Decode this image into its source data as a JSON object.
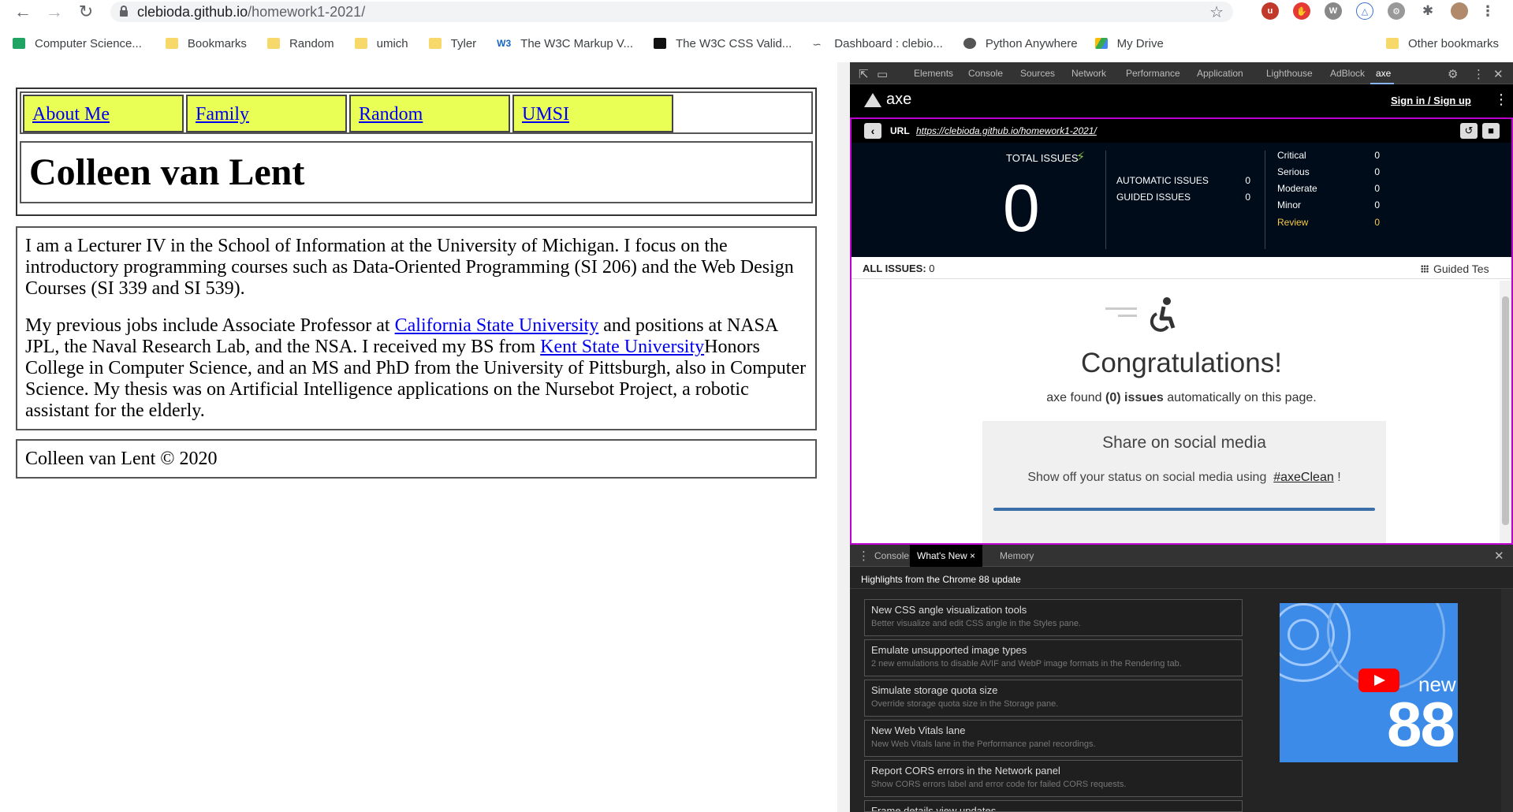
{
  "browser": {
    "url_host": "clebioda.github.io",
    "url_path": "/homework1-2021/",
    "bookmarks": [
      {
        "label": "Computer Science..."
      },
      {
        "label": "Bookmarks"
      },
      {
        "label": "Random"
      },
      {
        "label": "umich"
      },
      {
        "label": "Tyler"
      },
      {
        "label": "The W3C Markup V..."
      },
      {
        "label": "The W3C CSS Valid..."
      },
      {
        "label": "Dashboard : clebio..."
      },
      {
        "label": "Python Anywhere"
      },
      {
        "label": "My Drive"
      }
    ],
    "other_bookmarks": "Other bookmarks"
  },
  "page": {
    "nav": [
      "About Me",
      "Family",
      "Random",
      "UMSI"
    ],
    "title": "Colleen van Lent",
    "p1": "I am a Lecturer IV in the School of Information at the University of Michigan. I focus on the introductory programming courses such as Data-Oriented Programming (SI 206) and the Web Design Courses (SI 339 and SI 539).",
    "p2_a": "My previous jobs include Associate Professor at ",
    "p2_link1": "California State University",
    "p2_b": " and positions at NASA JPL, the Naval Research Lab, and the NSA. I received my BS from ",
    "p2_link2": "Kent State University",
    "p2_c": "Honors College in Computer Science, and an MS and PhD from the University of Pittsburgh, also in Computer Science. My thesis was on Artificial Intelligence applications on the Nursebot Project, a robotic assistant for the elderly.",
    "footer": "Colleen van Lent © 2020"
  },
  "devtools": {
    "tabs": [
      "Elements",
      "Console",
      "Sources",
      "Network",
      "Performance",
      "Application",
      "Lighthouse",
      "AdBlock",
      "axe"
    ],
    "active_tab": "axe",
    "axe": {
      "brand": "axe",
      "sign_in": "Sign in / Sign up",
      "url_label": "URL",
      "url_value": "https://clebioda.github.io/homework1-2021/",
      "total_issues_label": "TOTAL ISSUES",
      "total_issues": "0",
      "automatic_label": "AUTOMATIC ISSUES",
      "automatic": "0",
      "guided_label": "GUIDED ISSUES",
      "guided": "0",
      "severity": [
        {
          "label": "Critical",
          "value": "0"
        },
        {
          "label": "Serious",
          "value": "0"
        },
        {
          "label": "Moderate",
          "value": "0"
        },
        {
          "label": "Minor",
          "value": "0"
        },
        {
          "label": "Review",
          "value": "0"
        }
      ],
      "all_issues_label": "ALL ISSUES:",
      "all_issues_value": "0",
      "guided_tests": "Guided Tes",
      "congrats": "Congratulations!",
      "found_pre": "axe found ",
      "found_bold": "(0) issues",
      "found_post": " automatically on this page.",
      "share_title": "Share on social media",
      "share_text": "Show off your status on social media using",
      "share_tag": "#axeClean",
      "share_end": "!"
    },
    "drawer": {
      "tabs": [
        "Console",
        "What's New",
        "Memory"
      ],
      "active": "What's New",
      "highlights": "Highlights from the Chrome 88 update",
      "items": [
        {
          "title": "New CSS angle visualization tools",
          "desc": "Better visualize and edit CSS angle in the Styles pane."
        },
        {
          "title": "Emulate unsupported image types",
          "desc": "2 new emulations to disable AVIF and WebP image formats in the Rendering tab."
        },
        {
          "title": "Simulate storage quota size",
          "desc": "Override storage quota size in the Storage pane."
        },
        {
          "title": "New Web Vitals lane",
          "desc": "New Web Vitals lane in the Performance panel recordings."
        },
        {
          "title": "Report CORS errors in the Network panel",
          "desc": "Show CORS errors label and error code for failed CORS requests."
        },
        {
          "title": "Frame details view updates",
          "desc": ""
        }
      ],
      "video_new": "new",
      "video_num": "88"
    }
  }
}
